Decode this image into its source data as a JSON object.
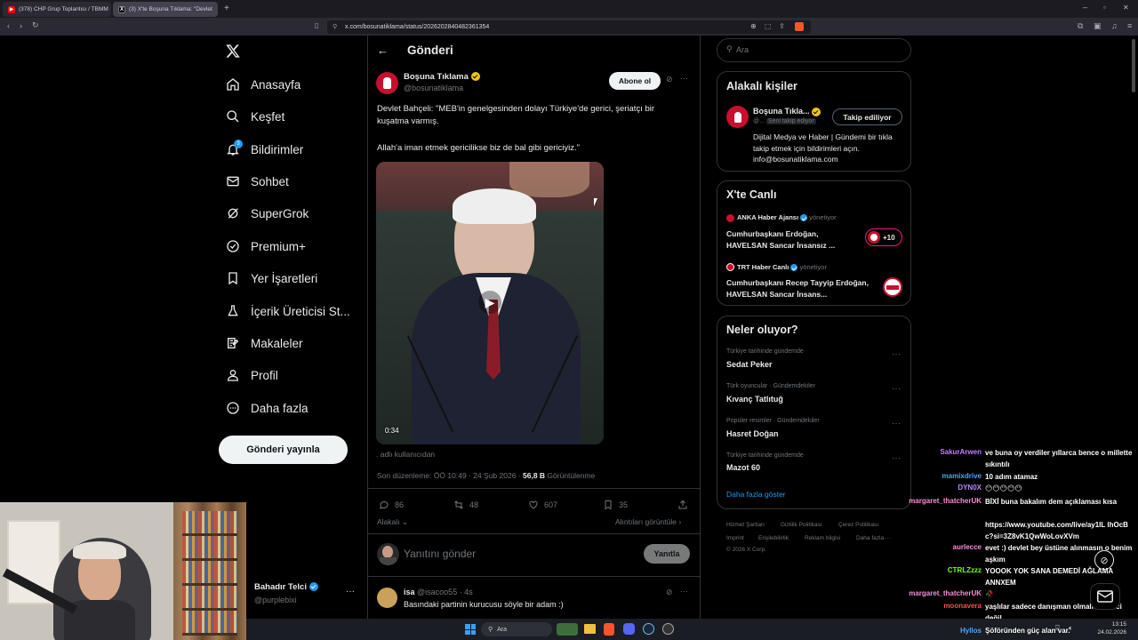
{
  "browser": {
    "tabs": [
      {
        "label": "(378) CHP Grup Toplantısı / TBMM",
        "active": false
      },
      {
        "label": "(3) X'te Boşuna Tıklama: \"Devlet",
        "active": true
      }
    ],
    "url": "x.com/bosunatiklama/status/2026202840482361354"
  },
  "nav": {
    "items": [
      {
        "label": "Anasayfa",
        "icon": "home-icon"
      },
      {
        "label": "Keşfet",
        "icon": "search-icon"
      },
      {
        "label": "Bildirimler",
        "icon": "bell-icon",
        "badge": "3"
      },
      {
        "label": "Sohbet",
        "icon": "mail-icon"
      },
      {
        "label": "SuperGrok",
        "icon": "grok-icon"
      },
      {
        "label": "Premium+",
        "icon": "premium-icon"
      },
      {
        "label": "Yer İşaretleri",
        "icon": "bookmark-icon"
      },
      {
        "label": "İçerik Üreticisi St...",
        "icon": "flask-icon"
      },
      {
        "label": "Makaleler",
        "icon": "article-icon"
      },
      {
        "label": "Profil",
        "icon": "person-icon"
      },
      {
        "label": "Daha fazla",
        "icon": "more-circle-icon"
      }
    ],
    "post_button": "Gönderi yayınla",
    "account": {
      "name": "Bahadır Telci",
      "handle": "@purplebixi"
    }
  },
  "header": {
    "title": "Gönderi"
  },
  "tweet": {
    "author_name": "Boşuna Tıklama",
    "author_handle": "@bosunatiklama",
    "subscribe_label": "Abone ol",
    "text_line1": "Devlet Bahçeli: \"MEB'in genelgesinden dolayı Türkiye'de gerici, şeriatçı bir kuşatma varmış.",
    "text_line2": "Allah'a iman etmek gericilikse biz de bal gibi gericiyiz.\"",
    "video_duration": "0:34",
    "attribution": ". adlı kullanıcıdan",
    "edited_label": "Son düzenleme:",
    "timestamp": "ÖÖ 10:49 · 24 Şub 2026 ·",
    "views_count": "56,8 B",
    "views_label": "Görüntülenme",
    "replies": "86",
    "retweets": "48",
    "likes": "607",
    "bookmarks": "35",
    "related_label": "Alakalı",
    "quotes_label": "Alıntıları görüntüle",
    "reply_placeholder": "Yanıtını gönder",
    "reply_button": "Yanıtla"
  },
  "reply": {
    "name": "isa",
    "handle": "@isacoo55",
    "time": "· 4s",
    "text": "Basındaki partinin kurucusu söyle bir adam :)"
  },
  "sidebar": {
    "search_placeholder": "Ara",
    "related": {
      "title": "Alakalı kişiler",
      "name": "Boşuna Tıkla...",
      "handle": "@...",
      "follows_you": "Seni takip ediyor",
      "follow_button": "Takip ediliyor",
      "bio": "Dijital Medya ve Haber | Gündemi bir tıkla takip etmek için bildirimleri açın. info@bosunatiklama.com"
    },
    "live": {
      "title": "X'te Canlı",
      "items": [
        {
          "host": "ANKA Haber Ajansı",
          "status": "yönetiyor",
          "title": "Cumhurbaşkanı Erdoğan, HAVELSAN Sancar İnsansız ...",
          "count": "+10"
        },
        {
          "host": "TRT Haber Canlı",
          "status": "yönetiyor",
          "title": "Cumhurbaşkanı Recep Tayyip Erdoğan, HAVELSAN Sancar İnsans..."
        }
      ]
    },
    "trends": {
      "title": "Neler oluyor?",
      "items": [
        {
          "meta": "Türkiye tarihinde gündemde",
          "title": "Sedat Peker"
        },
        {
          "meta": "Türk oyuncular · Gündemdekiler",
          "title": "Kıvanç Tatlıtuğ"
        },
        {
          "meta": "Popüler resimler · Gündemdekiler",
          "title": "Hasret Doğan"
        },
        {
          "meta": "Türkiye tarihinde gündemde",
          "title": "Mazot 60"
        }
      ],
      "show_more": "Daha fazla göster"
    },
    "footer": [
      "Hizmet Şartları",
      "Gizlilik Politikası",
      "Çerez Politikası",
      "Imprint",
      "Erişilebilirlik",
      "Reklam bilgisi",
      "Daha fazla ···",
      "© 2026 X Corp."
    ]
  },
  "chat": [
    {
      "user": "SakurArwen",
      "color": "#c77dff",
      "msg": "ve buna oy verdiler yıllarca bence o millette sıkıntılı"
    },
    {
      "user": "mamixdrive",
      "color": "#4da3ff",
      "msg": "10 adım atamaz"
    },
    {
      "user": "DYN0X",
      "color": "#b388ff",
      "msg": "😶😶😶😶😶"
    },
    {
      "user": "margaret_thatcherUK",
      "color": "#ff8ad8",
      "msg": "BİXİ buna bakalım dem açıklaması kısa"
    },
    {
      "user": "",
      "color": "#fff",
      "msg": "https://www.youtube.com/live/ay1IL lhOcBc?si=3Z8vK1QwWoLovXVm"
    },
    {
      "user": "aurlecce",
      "color": "#ff8ad8",
      "msg": "evet :) devlet bey üstüne alınmasın o benim aşkım"
    },
    {
      "user": "CTRLZzzz",
      "color": "#7cfc00",
      "msg": "YOOOK YOK SANA DEMEDİ AĞLAMA ANNXEM"
    },
    {
      "user": "margaret_thatcherUK",
      "color": "#ff8ad8",
      "msg": "🥀"
    },
    {
      "user": "moonavera",
      "color": "#ff4d4d",
      "msg": "yaşlılar sadece danışman olmalı temsilci değil"
    },
    {
      "user": "Hyllos",
      "color": "#4da3ff",
      "msg": "Şöföründen güç alan var."
    }
  ],
  "taskbar": {
    "search": "Ara",
    "time": "13:15",
    "date": "24.02.2026"
  }
}
